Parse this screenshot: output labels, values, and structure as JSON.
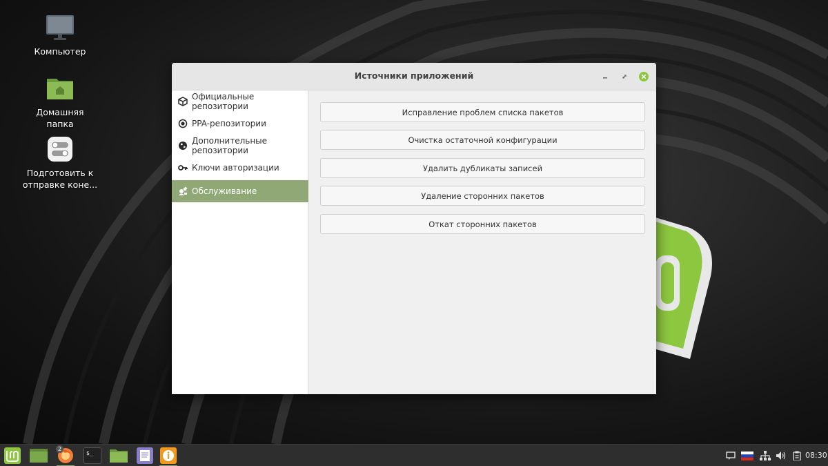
{
  "desktop": {
    "icons": [
      {
        "label_line1": "Компьютер",
        "label_line2": ""
      },
      {
        "label_line1": "Домашняя папка",
        "label_line2": ""
      },
      {
        "label_line1": "Подготовить к",
        "label_line2": "отправке коне..."
      }
    ]
  },
  "window": {
    "title": "Источники приложений",
    "controls": {
      "minimize": "–",
      "maximize": "⤢",
      "close": "×"
    }
  },
  "sidebar": {
    "items": [
      {
        "label": "Официальные репозитории",
        "icon": "package-icon",
        "active": false
      },
      {
        "label": "PPA-репозитории",
        "icon": "target-icon",
        "active": false
      },
      {
        "label": "Дополнительные репозитории",
        "icon": "globe-icon",
        "active": false
      },
      {
        "label": "Ключи авторизации",
        "icon": "key-icon",
        "active": false
      },
      {
        "label": "Обслуживание",
        "icon": "maintenance-icon",
        "active": true
      }
    ]
  },
  "main": {
    "buttons": [
      "Исправление проблем списка пакетов",
      "Очистка остаточной конфигурации",
      "Удалить дубликаты записей",
      "Удаление сторонних пакетов",
      "Откат сторонних пакетов"
    ]
  },
  "taskbar": {
    "apps": [
      {
        "name": "mint-menu-icon"
      },
      {
        "name": "show-desktop-icon"
      },
      {
        "name": "firefox-icon",
        "badge": "2"
      },
      {
        "name": "terminal-icon",
        "text": "$_"
      },
      {
        "name": "files-icon"
      },
      {
        "name": "text-editor-icon"
      },
      {
        "name": "software-sources-icon"
      }
    ],
    "tray": [
      "notification-icon",
      "language-flag-ru-icon",
      "network-icon",
      "volume-icon",
      "clipboard-icon"
    ],
    "clock": "08:30"
  },
  "colors": {
    "accent": "#8fa876",
    "mint_green": "#8dc63f",
    "taskbar_bg": "#2e2e2e"
  }
}
